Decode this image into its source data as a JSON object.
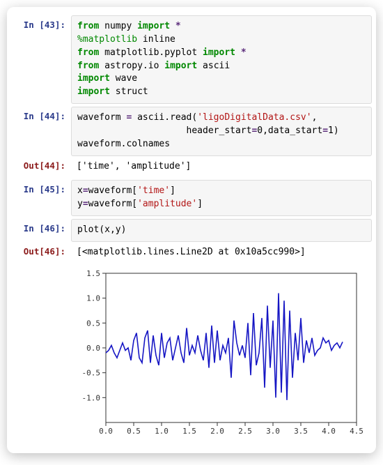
{
  "cells": {
    "c0": {
      "in_prompt": "In [43]:",
      "code_tokens": [
        [
          [
            "kw",
            "from"
          ],
          [
            "sp",
            " "
          ],
          [
            "mod",
            "numpy"
          ],
          [
            "sp",
            " "
          ],
          [
            "kw",
            "import"
          ],
          [
            "sp",
            " "
          ],
          [
            "op",
            "*"
          ]
        ],
        [
          [
            "magic",
            "%matplotlib"
          ],
          [
            "sp",
            " "
          ],
          [
            "mod",
            "inline"
          ]
        ],
        [
          [
            "kw",
            "from"
          ],
          [
            "sp",
            " "
          ],
          [
            "mod",
            "matplotlib.pyplot"
          ],
          [
            "sp",
            " "
          ],
          [
            "kw",
            "import"
          ],
          [
            "sp",
            " "
          ],
          [
            "op",
            "*"
          ]
        ],
        [
          [
            "kw",
            "from"
          ],
          [
            "sp",
            " "
          ],
          [
            "mod",
            "astropy.io"
          ],
          [
            "sp",
            " "
          ],
          [
            "kw",
            "import"
          ],
          [
            "sp",
            " "
          ],
          [
            "mod",
            "ascii"
          ]
        ],
        [
          [
            "kw",
            "import"
          ],
          [
            "sp",
            " "
          ],
          [
            "mod",
            "wave"
          ]
        ],
        [
          [
            "kw",
            "import"
          ],
          [
            "sp",
            " "
          ],
          [
            "mod",
            "struct"
          ]
        ]
      ]
    },
    "c1": {
      "in_prompt": "In [44]:",
      "code_tokens": [
        [
          [
            "name",
            "waveform "
          ],
          [
            "op",
            "="
          ],
          [
            "name",
            " ascii.read("
          ],
          [
            "str",
            "'ligoDigitalData.csv'"
          ],
          [
            "name",
            ","
          ]
        ],
        [
          [
            "name",
            "                    header_start"
          ],
          [
            "op",
            "="
          ],
          [
            "name",
            "0,data_start"
          ],
          [
            "op",
            "="
          ],
          [
            "name",
            "1)"
          ]
        ],
        [
          [
            "name",
            "waveform.colnames"
          ]
        ]
      ],
      "out_prompt": "Out[44]:",
      "out_text": "['time', 'amplitude']"
    },
    "c2": {
      "in_prompt": "In [45]:",
      "code_tokens": [
        [
          [
            "name",
            "x"
          ],
          [
            "op",
            "="
          ],
          [
            "name",
            "waveform["
          ],
          [
            "str",
            "'time'"
          ],
          [
            "name",
            "]"
          ]
        ],
        [
          [
            "name",
            "y"
          ],
          [
            "op",
            "="
          ],
          [
            "name",
            "waveform["
          ],
          [
            "str",
            "'amplitude'"
          ],
          [
            "name",
            "]"
          ]
        ]
      ]
    },
    "c3": {
      "in_prompt": "In [46]:",
      "code_tokens": [
        [
          [
            "name",
            "plot(x,y)"
          ]
        ]
      ],
      "out_prompt": "Out[46]:",
      "out_text": "[<matplotlib.lines.Line2D at 0x10a5cc990>]"
    }
  },
  "chart_data": {
    "type": "line",
    "title": "",
    "xlabel": "",
    "ylabel": "",
    "xlim": [
      0.0,
      4.5
    ],
    "ylim": [
      -1.5,
      1.5
    ],
    "xticks": [
      0.0,
      0.5,
      1.0,
      1.5,
      2.0,
      2.5,
      3.0,
      3.5,
      4.0,
      4.5
    ],
    "yticks": [
      -1.0,
      -0.5,
      0.0,
      0.5,
      1.0,
      1.5
    ],
    "xtick_labels": [
      "0.0",
      "0.5",
      "1.0",
      "1.5",
      "2.0",
      "2.5",
      "3.0",
      "3.5",
      "4.0",
      "4.5"
    ],
    "ytick_labels": [
      "-1.0",
      "-0.5",
      "0.0",
      "0.5",
      "1.0",
      "1.5"
    ],
    "series": [
      {
        "name": "amplitude",
        "color": "#1616c4",
        "x": [
          0.0,
          0.05,
          0.1,
          0.15,
          0.2,
          0.25,
          0.3,
          0.35,
          0.4,
          0.45,
          0.5,
          0.55,
          0.6,
          0.65,
          0.7,
          0.75,
          0.8,
          0.85,
          0.9,
          0.95,
          1.0,
          1.05,
          1.1,
          1.15,
          1.2,
          1.25,
          1.3,
          1.35,
          1.4,
          1.45,
          1.5,
          1.55,
          1.6,
          1.65,
          1.7,
          1.75,
          1.8,
          1.85,
          1.9,
          1.95,
          2.0,
          2.05,
          2.1,
          2.15,
          2.2,
          2.25,
          2.3,
          2.35,
          2.4,
          2.45,
          2.5,
          2.55,
          2.6,
          2.65,
          2.7,
          2.75,
          2.8,
          2.85,
          2.9,
          2.95,
          3.0,
          3.05,
          3.1,
          3.15,
          3.2,
          3.25,
          3.3,
          3.35,
          3.4,
          3.45,
          3.5,
          3.55,
          3.6,
          3.65,
          3.7,
          3.75,
          3.8,
          3.85,
          3.9,
          3.95,
          4.0,
          4.05,
          4.1,
          4.15,
          4.2,
          4.25
        ],
        "y": [
          -0.1,
          -0.05,
          0.05,
          -0.1,
          -0.2,
          -0.05,
          0.1,
          -0.05,
          0.0,
          -0.25,
          0.15,
          0.3,
          -0.2,
          -0.3,
          0.2,
          0.35,
          -0.3,
          0.25,
          -0.15,
          -0.35,
          0.3,
          -0.2,
          0.1,
          0.2,
          -0.25,
          0.0,
          0.25,
          -0.1,
          -0.3,
          0.4,
          -0.15,
          0.05,
          -0.1,
          0.25,
          -0.05,
          -0.25,
          0.3,
          -0.4,
          0.45,
          -0.3,
          0.35,
          -0.25,
          0.05,
          -0.1,
          0.2,
          -0.6,
          0.55,
          0.1,
          -0.15,
          0.05,
          -0.2,
          0.5,
          -0.55,
          0.7,
          -0.35,
          -0.1,
          0.6,
          -0.8,
          0.85,
          -0.4,
          0.55,
          -1.0,
          1.1,
          -0.9,
          0.95,
          -1.05,
          0.75,
          -0.6,
          0.3,
          -0.25,
          0.6,
          -0.3,
          0.15,
          -0.1,
          0.2,
          -0.15,
          -0.05,
          0.0,
          0.2,
          0.1,
          0.15,
          -0.05,
          0.05,
          0.1,
          0.0,
          0.12
        ]
      }
    ]
  }
}
